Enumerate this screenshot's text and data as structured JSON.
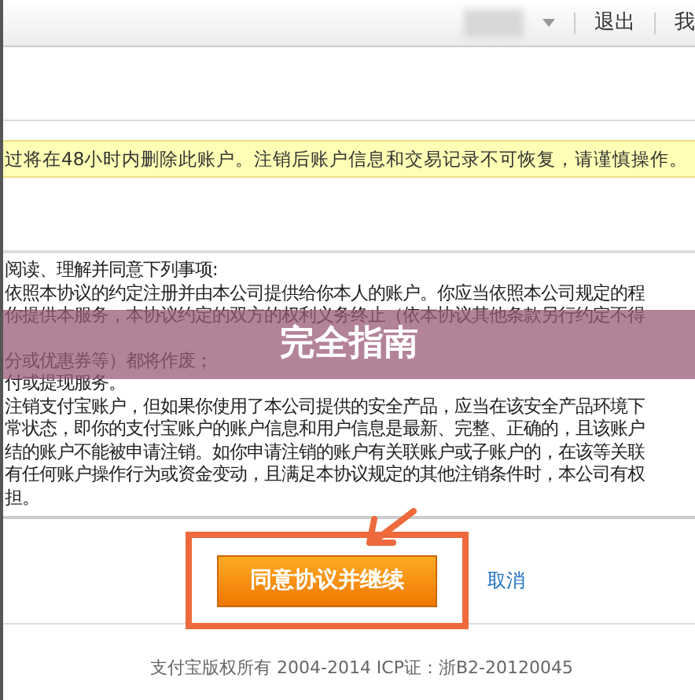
{
  "header": {
    "links": [
      "退出",
      "我"
    ]
  },
  "notice": "过将在48小时内删除此账户。注销后账户信息和交易记录不可恢复，请谨慎操作。",
  "terms": {
    "paragraphs": [
      [
        "阅读、理解并同意下列事项:",
        "依照本协议的约定注册并由本公司提供给你本人的账户。你应当依照本公司规定的程",
        "你提供本服务，本协议约定的双方的权利义务终止（依本协议其他条款另行约定不得"
      ],
      [
        "分或优惠券等）都将作废；",
        "付或提现服务。"
      ],
      [
        "注销支付宝账户，但如果你使用了本公司提供的安全产品，应当在该安全产品环境下",
        "常状态，即你的支付宝账户的账户信息和用户信息是最新、完整、正确的，且该账户",
        "结的账户不能被申请注销。如你申请注销的账户有关联账户或子账户的，在该等关联",
        "有任何账户操作行为或资金变动，且满足本协议规定的其他注销条件时，本公司有权",
        "担。"
      ]
    ]
  },
  "actions": {
    "primary": "同意协议并继续",
    "cancel": "取消"
  },
  "footer": "支付宝版权所有 2004-2014 ICP证：浙B2-20120045",
  "overlay": {
    "title": "完全指南"
  }
}
